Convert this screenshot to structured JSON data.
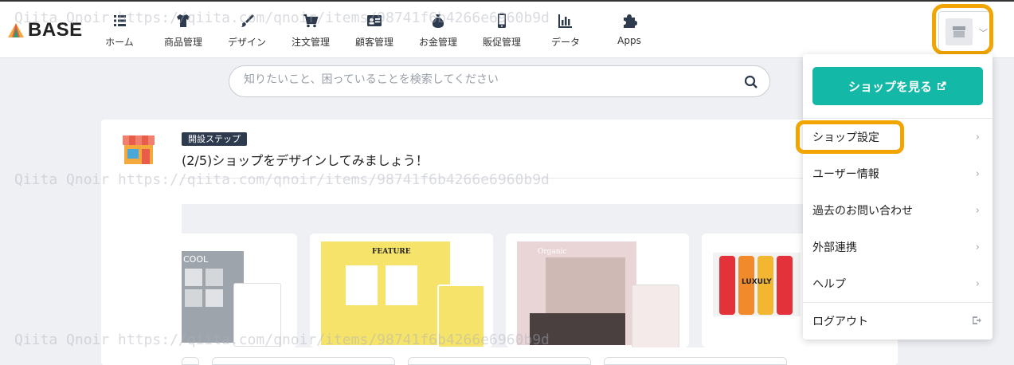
{
  "brand": {
    "name": "BASE"
  },
  "nav": {
    "items": [
      {
        "label": "ホーム",
        "icon": "list-icon"
      },
      {
        "label": "商品管理",
        "icon": "tshirt-icon"
      },
      {
        "label": "デザイン",
        "icon": "brush-icon"
      },
      {
        "label": "注文管理",
        "icon": "cart-icon"
      },
      {
        "label": "顧客管理",
        "icon": "id-card-icon"
      },
      {
        "label": "お金管理",
        "icon": "money-bag-icon"
      },
      {
        "label": "販促管理",
        "icon": "smartphone-icon"
      },
      {
        "label": "データ",
        "icon": "bar-chart-icon"
      },
      {
        "label": "Apps",
        "icon": "puzzle-icon"
      }
    ]
  },
  "search": {
    "placeholder": "知りたいこと、困っていることを検索してください"
  },
  "setup": {
    "badge": "開設ステップ",
    "title": "(2/5)ショップをデザインしてみましょう！"
  },
  "templates": [
    {
      "caption": "COOL"
    },
    {
      "caption": "FEATURE"
    },
    {
      "caption": "Organic"
    },
    {
      "caption": "LUXULY"
    }
  ],
  "menu": {
    "view_shop": "ショップを見る",
    "items": [
      {
        "label": "ショップ設定"
      },
      {
        "label": "ユーザー情報"
      },
      {
        "label": "過去のお問い合わせ"
      },
      {
        "label": "外部連携"
      },
      {
        "label": "ヘルプ"
      }
    ],
    "logout": "ログアウト"
  },
  "watermark": "Qiita  Qnoir  https://qiita.com/qnoir/items/98741f6b4266e6960b9d",
  "colors": {
    "accent": "#14b8a6",
    "highlight": "#f0a500",
    "badge": "#2e3a4e"
  }
}
